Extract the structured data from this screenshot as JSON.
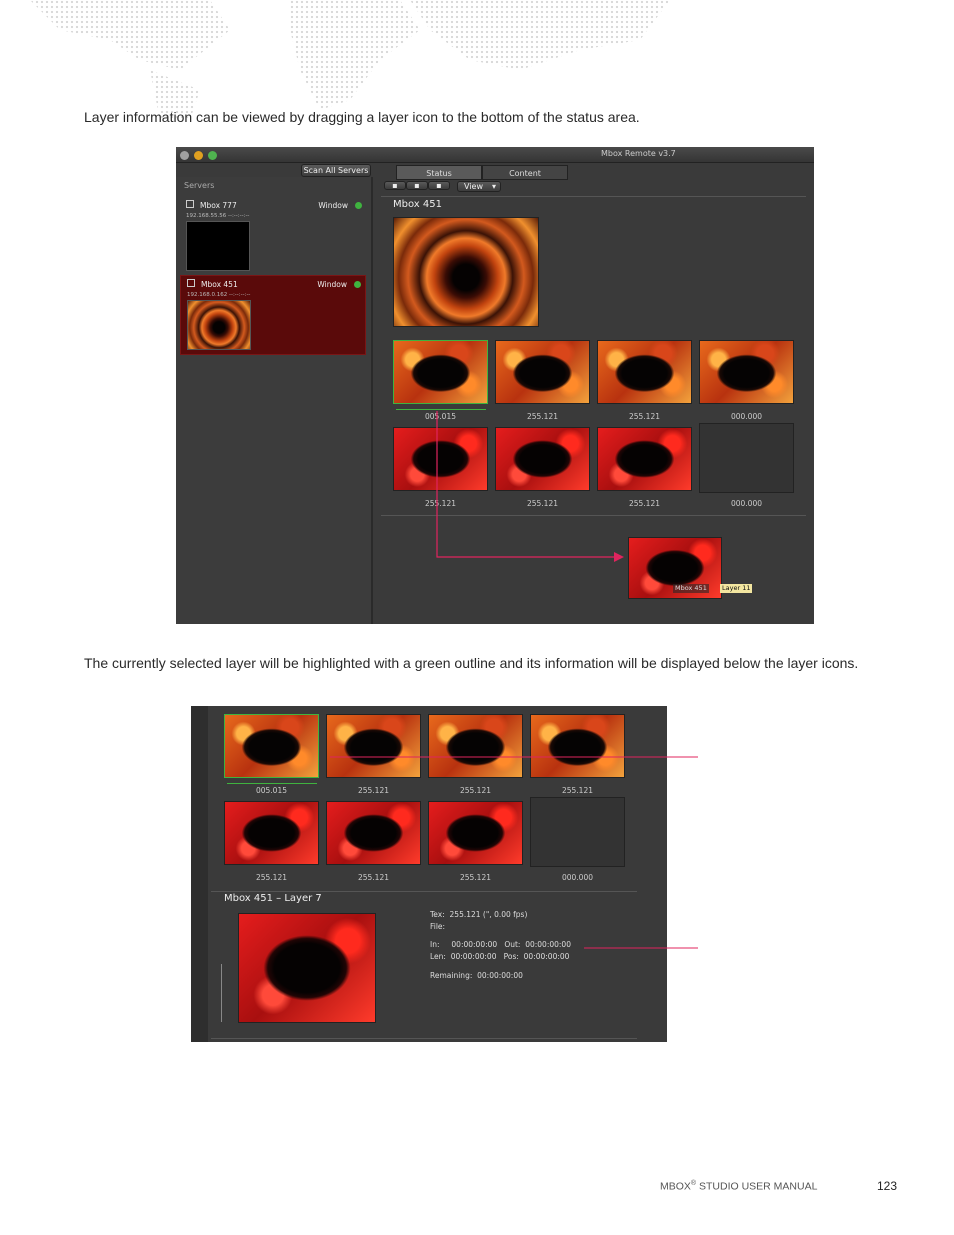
{
  "paragraph1": "Layer information can be viewed by dragging a layer icon to the bottom of the status area.",
  "paragraph2": "The currently selected layer will be highlighted with a green outline and its information will be displayed below the layer icons.",
  "footer": {
    "brand": "MBOX",
    "reg": "®",
    "manual": " STUDIO USER MANUAL",
    "page": "123"
  },
  "colors": {
    "callout": "#e0245e",
    "selected_green": "#3fb33f",
    "selected_server": "#5a0a0a"
  },
  "app": {
    "window_title": "Mbox Remote v3.7",
    "scan_button": "Scan All Servers",
    "servers_label": "Servers",
    "tabs": [
      "Status",
      "Content"
    ],
    "view_button": "View",
    "servers": [
      {
        "name": "Mbox 777",
        "ip": "192.168.55.56   --:--:--:--",
        "mode": "Window"
      },
      {
        "name": "Mbox 451",
        "ip": "192.168.0.162   --:--:--:--",
        "mode": "Window"
      }
    ],
    "status_title": "Mbox 451",
    "layer_captions": [
      "005.015",
      "255.121",
      "255.121",
      "000.000",
      "255.121",
      "255.121",
      "255.121",
      "000.000"
    ],
    "drag_tip_server": "Mbox 451",
    "drag_tip_layer": "Layer 11"
  },
  "detail": {
    "captions": [
      "005.015",
      "255.121",
      "255.121",
      "255.121",
      "255.121",
      "255.121",
      "255.121",
      "000.000"
    ],
    "title": "Mbox 451 – Layer 7",
    "tex": "Tex:  255.121 (\", 0.00 fps)",
    "file": "File:",
    "in_out": "In:     00:00:00:00   Out:  00:00:00:00",
    "len_pos": "Len:  00:00:00:00   Pos:  00:00:00:00",
    "remaining": "Remaining:  00:00:00:00"
  }
}
